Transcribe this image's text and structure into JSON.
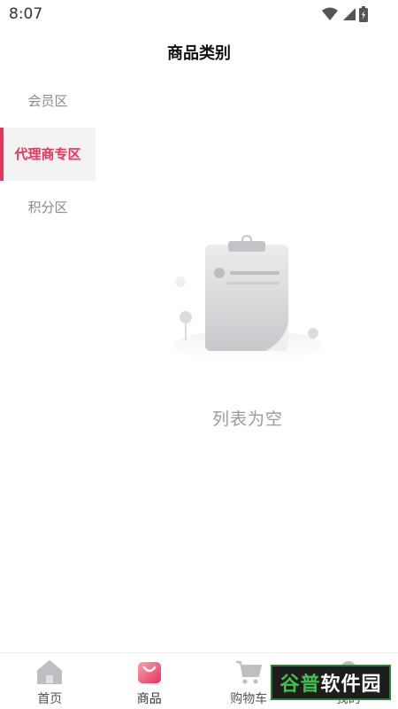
{
  "status": {
    "time": "8:07"
  },
  "header": {
    "title": "商品类别"
  },
  "sidebar": {
    "items": [
      {
        "label": "会员区",
        "active": false
      },
      {
        "label": "代理商专区",
        "active": true
      },
      {
        "label": "积分区",
        "active": false
      }
    ]
  },
  "content": {
    "empty_text": "列表为空"
  },
  "tabbar": {
    "tabs": [
      {
        "label": "首页",
        "icon": "home-icon"
      },
      {
        "label": "商品",
        "icon": "shopping-bag-icon",
        "active": true
      },
      {
        "label": "购物车",
        "icon": "cart-icon"
      },
      {
        "label": "我的",
        "icon": "profile-icon"
      }
    ]
  },
  "watermark": {
    "text_accent": "谷普",
    "text_main": "软件园"
  },
  "colors": {
    "accent": "#e8335a",
    "muted": "#9a9a9a"
  }
}
